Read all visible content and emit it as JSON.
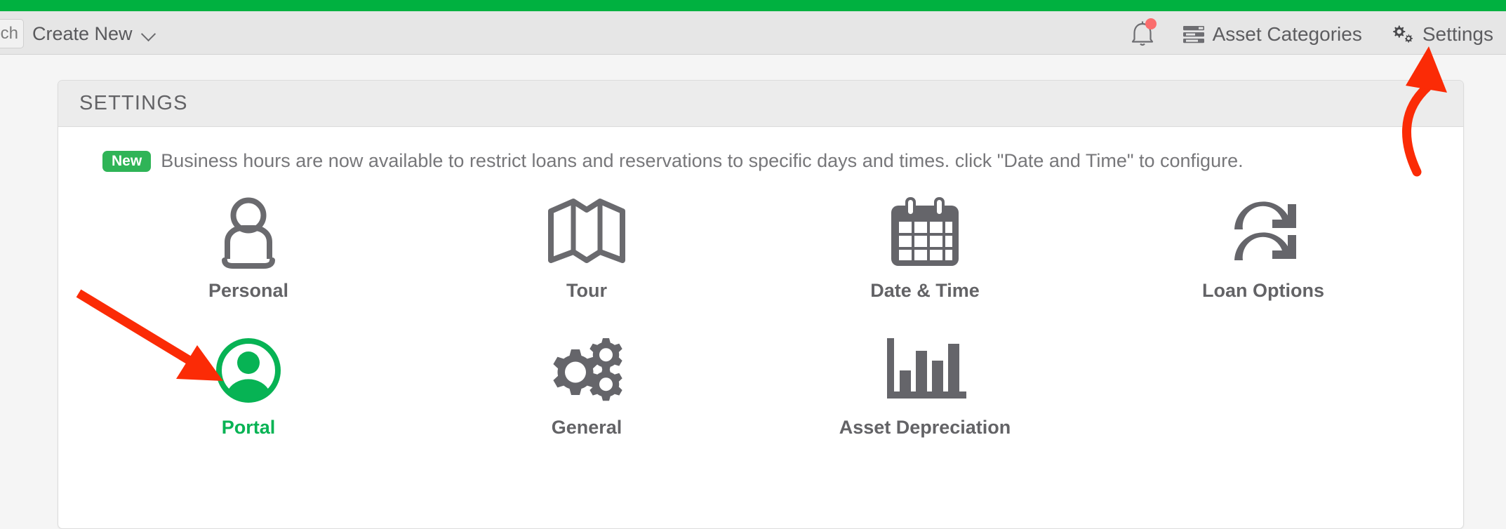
{
  "brand": {
    "accent_green": "#00b140",
    "arrow_red": "#fb2b06",
    "icon_gray": "#65656a"
  },
  "header": {
    "search_stub_text": "ch",
    "create_new_label": "Create New",
    "create_new_icon": "chevron-down-icon",
    "notification_icon": "bell-icon",
    "notification_badge": "",
    "asset_categories_label": "Asset Categories",
    "asset_categories_icon": "list-rows-icon",
    "settings_label": "Settings",
    "settings_icon": "gears-icon"
  },
  "panel": {
    "title": "SETTINGS",
    "notice": {
      "badge": "New",
      "text": "Business hours are now available to restrict loans and reservations to specific days and times. click \"Date and Time\" to configure."
    },
    "rows": [
      [
        {
          "label": "Personal",
          "icon": "person-outline-icon",
          "active": false
        },
        {
          "label": "Tour",
          "icon": "folded-map-icon",
          "active": false
        },
        {
          "label": "Date & Time",
          "icon": "calendar-icon",
          "active": false
        },
        {
          "label": "Loan Options",
          "icon": "refresh-sync-icon",
          "active": false
        }
      ],
      [
        {
          "label": "Portal",
          "icon": "user-circle-icon",
          "active": true
        },
        {
          "label": "General",
          "icon": "gears-icon",
          "active": false
        },
        {
          "label": "Asset Depreciation",
          "icon": "bar-chart-icon",
          "active": false
        }
      ]
    ]
  },
  "annotations": [
    {
      "name": "arrow-to-settings",
      "shape": "curved-arrow-up",
      "color": "#fb2b06"
    },
    {
      "name": "arrow-to-portal",
      "shape": "straight-arrow-down-right",
      "color": "#fb2b06"
    }
  ]
}
